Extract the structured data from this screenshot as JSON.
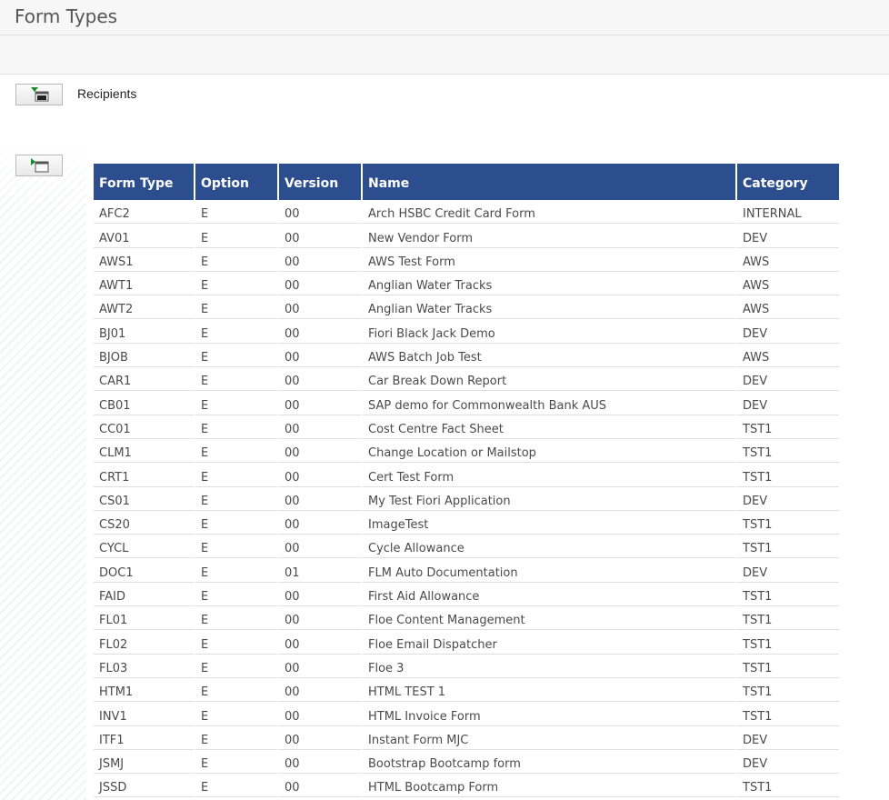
{
  "page": {
    "title": "Form Types"
  },
  "section": {
    "recipients_label": "Recipients"
  },
  "colors": {
    "header_bg": "#2d4e8e",
    "header_text": "#ffffff",
    "arrow_green": "#1a8a2e"
  },
  "icons": {
    "expand_recipients": "expand-arrow-icon",
    "expand_forms": "expand-arrow-icon"
  },
  "table": {
    "columns": [
      "Form Type",
      "Option",
      "Version",
      "Name",
      "Category"
    ],
    "rows": [
      [
        "AFC2",
        "E",
        "00",
        "Arch HSBC Credit Card Form",
        "INTERNAL"
      ],
      [
        "AV01",
        "E",
        "00",
        "New Vendor Form",
        "DEV"
      ],
      [
        "AWS1",
        "E",
        "00",
        "AWS Test Form",
        "AWS"
      ],
      [
        "AWT1",
        "E",
        "00",
        "Anglian Water Tracks",
        "AWS"
      ],
      [
        "AWT2",
        "E",
        "00",
        "Anglian Water Tracks",
        "AWS"
      ],
      [
        "BJ01",
        "E",
        "00",
        "Fiori Black Jack Demo",
        "DEV"
      ],
      [
        "BJOB",
        "E",
        "00",
        "AWS Batch Job Test",
        "AWS"
      ],
      [
        "CAR1",
        "E",
        "00",
        "Car Break Down Report",
        "DEV"
      ],
      [
        "CB01",
        "E",
        "00",
        "SAP demo for Commonwealth Bank AUS",
        "DEV"
      ],
      [
        "CC01",
        "E",
        "00",
        "Cost Centre Fact Sheet",
        "TST1"
      ],
      [
        "CLM1",
        "E",
        "00",
        "Change Location or Mailstop",
        "TST1"
      ],
      [
        "CRT1",
        "E",
        "00",
        "Cert Test Form",
        "TST1"
      ],
      [
        "CS01",
        "E",
        "00",
        "My Test Fiori Application",
        "DEV"
      ],
      [
        "CS20",
        "E",
        "00",
        "ImageTest",
        "TST1"
      ],
      [
        "CYCL",
        "E",
        "00",
        "Cycle Allowance",
        "TST1"
      ],
      [
        "DOC1",
        "E",
        "01",
        "FLM Auto Documentation",
        "DEV"
      ],
      [
        "FAID",
        "E",
        "00",
        "First Aid Allowance",
        "TST1"
      ],
      [
        "FL01",
        "E",
        "00",
        "Floe Content Management",
        "TST1"
      ],
      [
        "FL02",
        "E",
        "00",
        "Floe Email Dispatcher",
        "TST1"
      ],
      [
        "FL03",
        "E",
        "00",
        "Floe 3",
        "TST1"
      ],
      [
        "HTM1",
        "E",
        "00",
        "HTML TEST 1",
        "TST1"
      ],
      [
        "INV1",
        "E",
        "00",
        "HTML Invoice Form",
        "TST1"
      ],
      [
        "ITF1",
        "E",
        "00",
        "Instant Form MJC",
        "DEV"
      ],
      [
        "JSMJ",
        "E",
        "00",
        "Bootstrap Bootcamp form",
        "DEV"
      ],
      [
        "JSSD",
        "E",
        "00",
        "HTML Bootcamp Form",
        "TST1"
      ]
    ]
  }
}
